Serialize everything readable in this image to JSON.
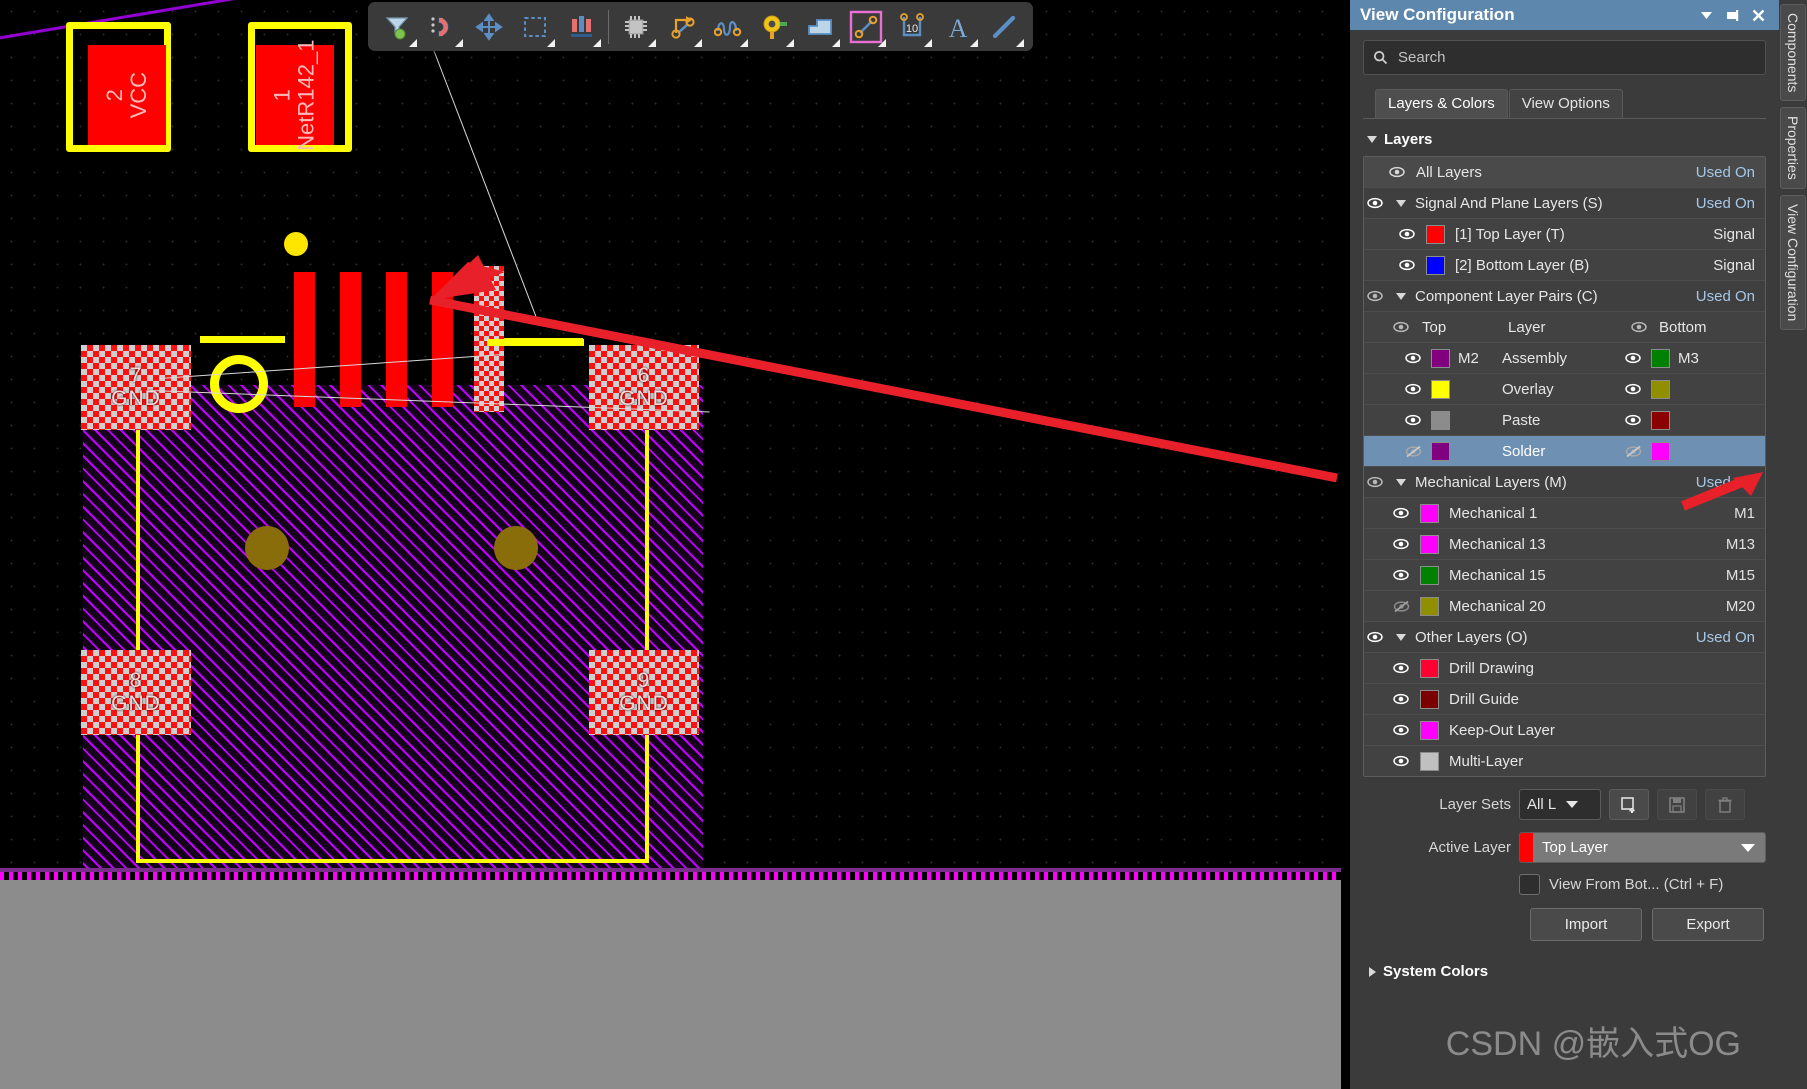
{
  "panel": {
    "title": "View Configuration",
    "title_buttons": [
      {
        "name": "collapse-icon",
        "glyph": "▼"
      },
      {
        "name": "pin-icon",
        "glyph": "⊞"
      },
      {
        "name": "close-icon",
        "glyph": "✕"
      }
    ],
    "search": {
      "placeholder": "Search",
      "value": "",
      "icon": "search-icon"
    },
    "tabs": [
      {
        "label": "Layers & Colors",
        "selected": true
      },
      {
        "label": "View Options",
        "selected": false
      }
    ],
    "layers_section": {
      "label": "Layers",
      "expanded": true
    },
    "system_colors_section": {
      "label": "System Colors",
      "expanded": false
    },
    "used_on_label": "Used On",
    "signal_label": "Signal",
    "layers": [
      {
        "type": "all",
        "name": "All Layers",
        "right": "Used On",
        "visible": true,
        "indent": 0
      },
      {
        "type": "group",
        "name": "Signal And Plane Layers (S)",
        "right": "Used On",
        "visible": true,
        "indent": 0,
        "expanded": true
      },
      {
        "type": "layer",
        "name": "[1] Top Layer (T)",
        "right": "Signal",
        "color": "#ff0000",
        "visible": true,
        "indent": 1
      },
      {
        "type": "layer",
        "name": "[2] Bottom Layer (B)",
        "right": "Signal",
        "color": "#0000ff",
        "visible": true,
        "indent": 1
      },
      {
        "type": "group",
        "name": "Component Layer Pairs (C)",
        "right": "Used On",
        "visible": true,
        "indent": 0,
        "expanded": true
      },
      {
        "type": "pairhdr",
        "left_label": "Top",
        "mid_label": "Layer",
        "right_label": "Bottom",
        "visible": true
      },
      {
        "type": "pair",
        "name": "Assembly",
        "left_tag": "M2",
        "left_color": "#800080",
        "left_visible": true,
        "right_tag": "M3",
        "right_color": "#008000",
        "right_visible": true
      },
      {
        "type": "pair",
        "name": "Overlay",
        "left_tag": "",
        "left_color": "#ffff00",
        "left_visible": true,
        "right_tag": "",
        "right_color": "#8f8f00",
        "right_visible": true
      },
      {
        "type": "pair",
        "name": "Paste",
        "left_tag": "",
        "left_color": "#8c8c8c",
        "left_visible": true,
        "right_tag": "",
        "right_color": "#8b0000",
        "right_visible": true
      },
      {
        "type": "pair",
        "name": "Solder",
        "left_tag": "",
        "left_color": "#800080",
        "left_visible": false,
        "right_tag": "",
        "right_color": "#ff00ff",
        "right_visible": false,
        "selected": true
      },
      {
        "type": "group",
        "name": "Mechanical Layers (M)",
        "right": "Used On",
        "visible": true,
        "indent": 0,
        "expanded": true
      },
      {
        "type": "layer",
        "name": "Mechanical 1",
        "right": "M1",
        "color": "#ff00ff",
        "visible": true,
        "indent": 1
      },
      {
        "type": "layer",
        "name": "Mechanical 13",
        "right": "M13",
        "color": "#ff00ff",
        "visible": true,
        "indent": 1
      },
      {
        "type": "layer",
        "name": "Mechanical 15",
        "right": "M15",
        "color": "#008000",
        "visible": true,
        "indent": 1
      },
      {
        "type": "layer",
        "name": "Mechanical 20",
        "right": "M20",
        "color": "#8f8f00",
        "visible": false,
        "indent": 1
      },
      {
        "type": "group",
        "name": "Other Layers (O)",
        "right": "Used On",
        "visible": true,
        "indent": 0,
        "expanded": true
      },
      {
        "type": "layer",
        "name": "Drill Drawing",
        "right": "",
        "color": "#ff0033",
        "visible": true,
        "indent": 1
      },
      {
        "type": "layer",
        "name": "Drill Guide",
        "right": "",
        "color": "#7a0000",
        "visible": true,
        "indent": 1
      },
      {
        "type": "layer",
        "name": "Keep-Out Layer",
        "right": "",
        "color": "#ff00ff",
        "visible": true,
        "indent": 1
      },
      {
        "type": "layer",
        "name": "Multi-Layer",
        "right": "",
        "color": "#c0c0c0",
        "visible": true,
        "indent": 1
      }
    ],
    "layer_sets": {
      "label": "Layer Sets",
      "value": "All L",
      "add_icon": "add-layer-set-icon",
      "save_icon": "save-icon",
      "delete_icon": "trash-icon"
    },
    "active_layer": {
      "label": "Active Layer",
      "value": "Top Layer",
      "color": "#ff0000"
    },
    "view_from_bottom": {
      "label": "View From Bot... (Ctrl + F)",
      "checked": false
    },
    "buttons": {
      "import": "Import",
      "export": "Export"
    }
  },
  "edge_tabs": [
    {
      "label": "Components"
    },
    {
      "label": "Properties"
    },
    {
      "label": "View Configuration"
    }
  ],
  "toolbar": {
    "items": [
      {
        "name": "filter-tool",
        "icon": "funnel-icon",
        "has_caret": true
      },
      {
        "name": "snap-magnet-tool",
        "icon": "magnet-icon",
        "has_caret": true
      },
      {
        "name": "move-tool",
        "icon": "move-cross-icon",
        "has_caret": false
      },
      {
        "name": "area-select-tool",
        "icon": "dashed-rect-icon",
        "has_caret": true
      },
      {
        "name": "align-tool",
        "icon": "align-bars-icon",
        "has_caret": true
      },
      {
        "name": "separator",
        "icon": "separator",
        "has_caret": false
      },
      {
        "name": "place-component-tool",
        "icon": "chip-icon",
        "has_caret": true
      },
      {
        "name": "route-track-tool",
        "icon": "track-route-icon",
        "has_caret": true
      },
      {
        "name": "interactive-length-tune-tool",
        "icon": "squiggle-icon",
        "has_caret": true
      },
      {
        "name": "place-via-tool",
        "icon": "via-pad-icon",
        "has_caret": true
      },
      {
        "name": "place-polygon-tool",
        "icon": "polygon-fill-icon",
        "has_caret": true
      },
      {
        "name": "place-line-tool",
        "icon": "line-segment-icon",
        "has_caret": true,
        "highlighted": true
      },
      {
        "name": "place-dimension-tool",
        "icon": "dimension-10-icon",
        "has_caret": true
      },
      {
        "name": "place-string-tool",
        "icon": "text-a-icon",
        "has_caret": true
      },
      {
        "name": "place-track-tool",
        "icon": "diagonal-line-icon",
        "has_caret": true
      }
    ]
  },
  "canvas": {
    "pads": [
      {
        "name": "pad-2-vcc",
        "designator": "2",
        "net": "VCC"
      },
      {
        "name": "pad-1-netr142",
        "designator": "1",
        "net": "NetR142_1"
      },
      {
        "name": "pad-7-gnd",
        "designator": "7",
        "net": "GND"
      },
      {
        "name": "pad-6-gnd",
        "designator": "6",
        "net": "GND"
      },
      {
        "name": "pad-8-gnd",
        "designator": "8",
        "net": "GND"
      },
      {
        "name": "pad-9-gnd",
        "designator": "9",
        "net": "GND"
      }
    ]
  },
  "watermark": {
    "text": "CSDN @嵌入式OG"
  }
}
